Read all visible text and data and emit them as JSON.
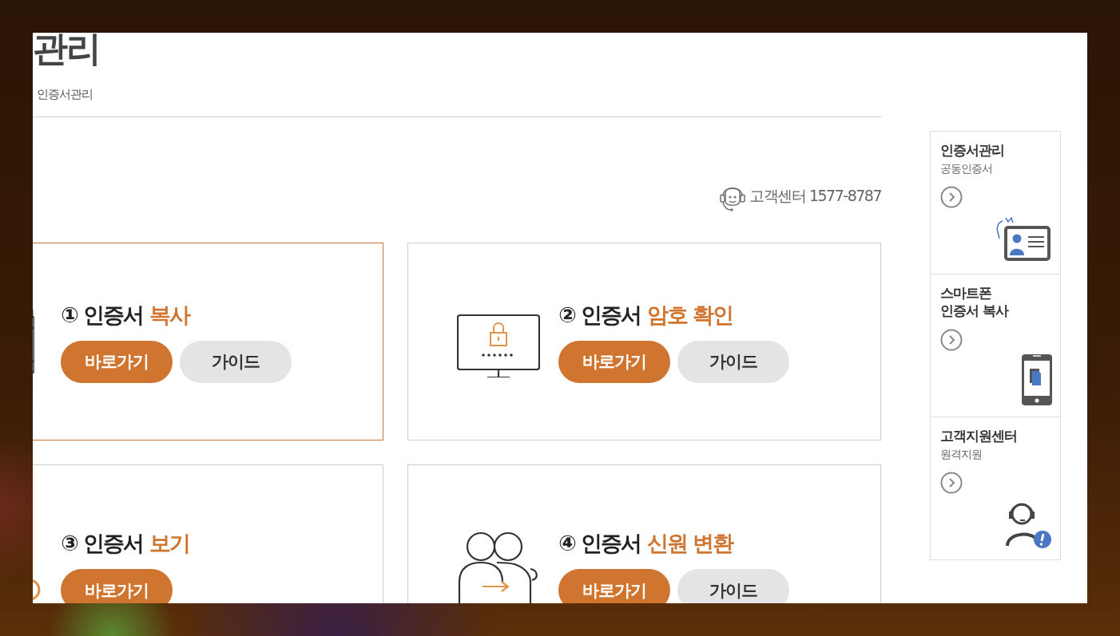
{
  "page": {
    "title": "관리",
    "breadcrumb": "인증서관리"
  },
  "help_line": {
    "label": "고객센터 1577-8787"
  },
  "cards": [
    {
      "number": "①",
      "title": "인증서",
      "accent": "복사",
      "selected": true,
      "buttons": [
        {
          "label": "바로가기",
          "kind": "primary"
        },
        {
          "label": "가이드",
          "kind": "secondary"
        }
      ]
    },
    {
      "number": "②",
      "title": "인증서",
      "accent": "암호 확인",
      "selected": false,
      "buttons": [
        {
          "label": "바로가기",
          "kind": "primary"
        },
        {
          "label": "가이드",
          "kind": "secondary"
        }
      ]
    },
    {
      "number": "③",
      "title": "인증서",
      "accent": "보기",
      "selected": false,
      "buttons": [
        {
          "label": "바로가기",
          "kind": "primary"
        }
      ]
    },
    {
      "number": "④",
      "title": "인증서",
      "accent": "신원 변환",
      "selected": false,
      "buttons": [
        {
          "label": "바로가기",
          "kind": "primary"
        },
        {
          "label": "가이드",
          "kind": "secondary"
        }
      ]
    }
  ],
  "sidebar": [
    {
      "title_lines": [
        "인증서관리"
      ],
      "subtitle": "공동인증서"
    },
    {
      "title_lines": [
        "스마트폰",
        "인증서 복사"
      ]
    },
    {
      "title_lines": [
        "고객지원센터"
      ],
      "subtitle": "원격지원"
    }
  ]
}
